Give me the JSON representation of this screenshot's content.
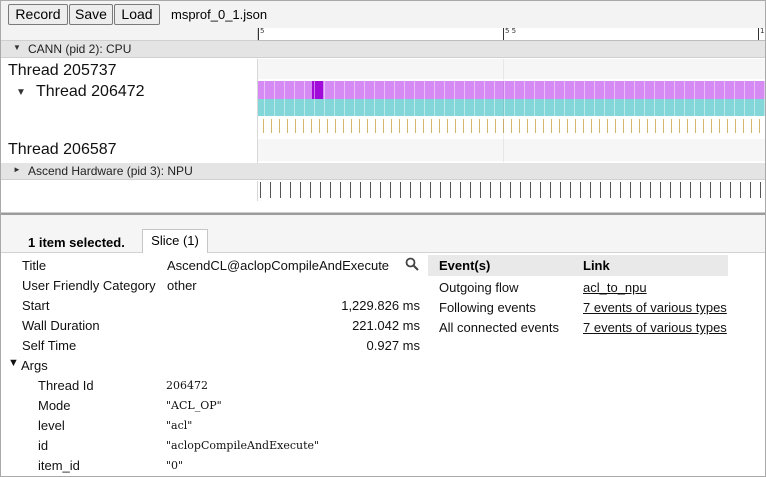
{
  "toolbar": {
    "record_label": "Record",
    "save_label": "Save",
    "load_label": "Load",
    "filename": "msprof_0_1.json"
  },
  "ruler": {
    "labels": [
      "5",
      "5 5",
      "1"
    ]
  },
  "processes": {
    "cpu": {
      "label": "CANN (pid 2): CPU",
      "expanded": true
    },
    "npu": {
      "label": "Ascend Hardware (pid 3): NPU",
      "expanded": false
    }
  },
  "threads": [
    {
      "label": "Thread 205737"
    },
    {
      "label": "Thread 206472",
      "expanded": true
    },
    {
      "label": "Thread 206587"
    }
  ],
  "track_colors": {
    "slice": "#d58af4",
    "slice_selected": "#a10bd9",
    "sub_slice": "#84d7d9",
    "flow_ticks": "#d4b66d"
  },
  "panel": {
    "selection_text": "1 item selected.",
    "tab_label": "Slice (1)",
    "details": {
      "title_key": "Title",
      "title_value": "AscendCL@aclopCompileAndExecute",
      "category_key": "User Friendly Category",
      "category_value": "other",
      "start_key": "Start",
      "start_value": "1,229.826 ms",
      "wall_key": "Wall Duration",
      "wall_value": "221.042 ms",
      "self_key": "Self Time",
      "self_value": "0.927 ms",
      "args_key": "Args"
    },
    "args": [
      {
        "key": "Thread Id",
        "value": "206472"
      },
      {
        "key": "Mode",
        "value": "\"ACL_OP\""
      },
      {
        "key": "level",
        "value": "\"acl\""
      },
      {
        "key": "id",
        "value": "\"aclopCompileAndExecute\""
      },
      {
        "key": "item_id",
        "value": "\"0\""
      }
    ],
    "events": {
      "header_events": "Event(s)",
      "header_link": "Link",
      "rows": [
        {
          "event": "Outgoing flow",
          "link": "acl_to_npu"
        },
        {
          "event": "Following events",
          "link": "7 events of various types"
        },
        {
          "event": "All connected events",
          "link": "7 events of various types"
        }
      ]
    }
  }
}
